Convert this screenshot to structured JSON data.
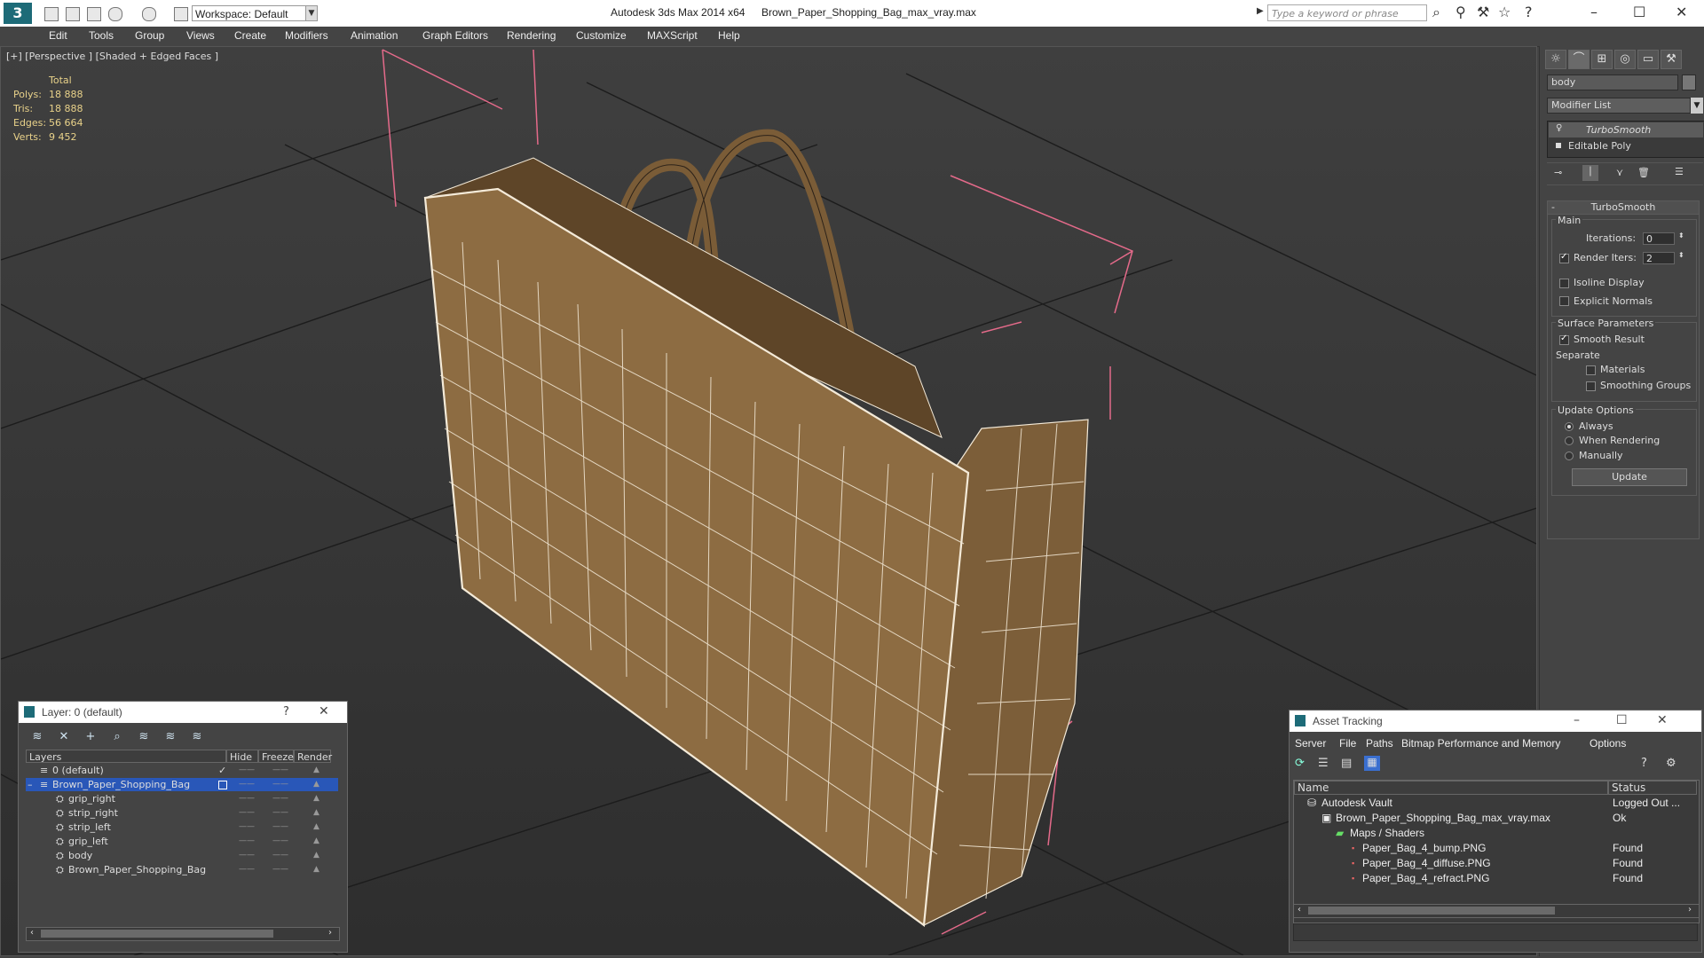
{
  "titlebar": {
    "app_title": "Autodesk 3ds Max  2014 x64",
    "file_title": "Brown_Paper_Shopping_Bag_max_vray.max",
    "workspace": "Workspace: Default",
    "search_placeholder": "Type a keyword or phrase",
    "logo": "3",
    "icons": [
      "new-icon",
      "open-icon",
      "save-icon",
      "undo-icon",
      "redo-icon",
      "project-icon",
      "binoculars-icon",
      "account-icon",
      "star-icon",
      "help-icon"
    ]
  },
  "menu": [
    "Edit",
    "Tools",
    "Group",
    "Views",
    "Create",
    "Modifiers",
    "Animation",
    "Graph Editors",
    "Rendering",
    "Customize",
    "MAXScript",
    "Help"
  ],
  "viewport": {
    "label": "[+] [Perspective ] [Shaded + Edged Faces ]",
    "stats": {
      "header": "Total",
      "rows": [
        {
          "k": "Polys:",
          "v": "18 888"
        },
        {
          "k": "Tris:",
          "v": "18 888"
        },
        {
          "k": "Edges:",
          "v": "56 664"
        },
        {
          "k": "Verts:",
          "v": "9 452"
        }
      ]
    },
    "colors": {
      "bag": "#8d6c42",
      "wire": "#f4ead8",
      "bbox": "#e46a8a"
    }
  },
  "command_panel": {
    "object_name": "body",
    "modifier_list": "Modifier List",
    "stack": [
      "TurboSmooth",
      "Editable Poly"
    ],
    "rollout_title": "TurboSmooth",
    "main": {
      "title": "Main",
      "iterations_label": "Iterations:",
      "iterations": "0",
      "render_iters_label": "Render Iters:",
      "render_iters": "2",
      "isoline": "Isoline Display",
      "explicit": "Explicit Normals"
    },
    "surface": {
      "title": "Surface Parameters",
      "smooth": "Smooth Result",
      "separate": "Separate",
      "materials": "Materials",
      "smoothing": "Smoothing Groups"
    },
    "update": {
      "title": "Update Options",
      "always": "Always",
      "rendering": "When Rendering",
      "manually": "Manually",
      "button": "Update"
    }
  },
  "layer_window": {
    "title": "Layer: 0 (default)",
    "help": "?",
    "columns": [
      "Layers",
      "Hide",
      "Freeze",
      "Render"
    ],
    "rows": [
      {
        "name": "0 (default)",
        "level": 1,
        "selected": false
      },
      {
        "name": "Brown_Paper_Shopping_Bag",
        "level": 1,
        "selected": true
      },
      {
        "name": "grip_right",
        "level": 2,
        "selected": false
      },
      {
        "name": "strip_right",
        "level": 2,
        "selected": false
      },
      {
        "name": "strip_left",
        "level": 2,
        "selected": false
      },
      {
        "name": "grip_left",
        "level": 2,
        "selected": false
      },
      {
        "name": "body",
        "level": 2,
        "selected": false
      },
      {
        "name": "Brown_Paper_Shopping_Bag",
        "level": 2,
        "selected": false
      }
    ],
    "dash": "——"
  },
  "asset_window": {
    "title": "Asset Tracking",
    "menu": [
      "Server",
      "File",
      "Paths",
      "Bitmap Performance and Memory",
      "Options"
    ],
    "columns": [
      "Name",
      "Status"
    ],
    "rows": [
      {
        "name": "Autodesk Vault",
        "status": "Logged Out ...",
        "level": 0
      },
      {
        "name": "Brown_Paper_Shopping_Bag_max_vray.max",
        "status": "Ok",
        "level": 1
      },
      {
        "name": "Maps / Shaders",
        "status": "",
        "level": 2
      },
      {
        "name": "Paper_Bag_4_bump.PNG",
        "status": "Found",
        "level": 3
      },
      {
        "name": "Paper_Bag_4_diffuse.PNG",
        "status": "Found",
        "level": 3
      },
      {
        "name": "Paper_Bag_4_refract.PNG",
        "status": "Found",
        "level": 3
      }
    ]
  }
}
